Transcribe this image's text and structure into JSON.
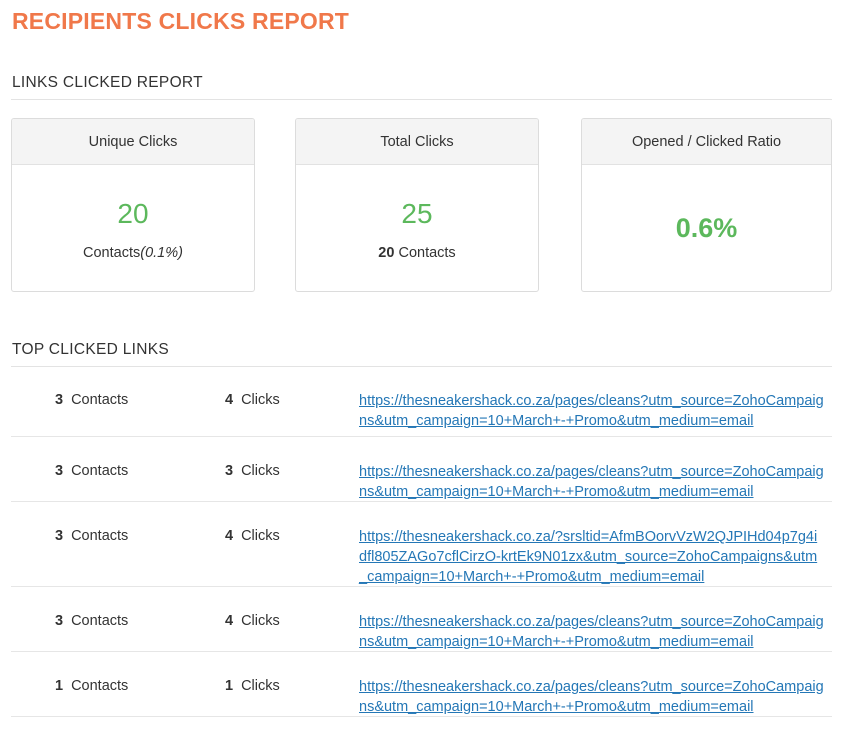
{
  "page": {
    "title": "RECIPIENTS CLICKS REPORT"
  },
  "links_report": {
    "heading": "LINKS CLICKED REPORT",
    "unique_clicks": {
      "label": "Unique Clicks",
      "value": "20",
      "sub_label": "Contacts",
      "sub_percent": "(0.1%)"
    },
    "total_clicks": {
      "label": "Total Clicks",
      "value": "25",
      "sub_count": "20",
      "sub_label": " Contacts"
    },
    "ratio": {
      "label": "Opened / Clicked Ratio",
      "value": "0.6%"
    }
  },
  "top_links": {
    "heading": "TOP CLICKED LINKS",
    "contacts_label": "Contacts",
    "clicks_label": "Clicks",
    "rows": [
      {
        "contacts": "3",
        "clicks": "4",
        "url": "https://thesneakershack.co.za/pages/cleans?utm_source=ZohoCampaigns&utm_campaign=10+March+-+Promo&utm_medium=email"
      },
      {
        "contacts": "3",
        "clicks": "3",
        "url": "https://thesneakershack.co.za/pages/cleans?utm_source=ZohoCampaigns&utm_campaign=10+March+-+Promo&utm_medium=email"
      },
      {
        "contacts": "3",
        "clicks": "4",
        "url": "https://thesneakershack.co.za/?srsltid=AfmBOorvVzW2QJPIHd04p7g4idfl805ZAGo7cflCirzO-krtEk9N01zx&utm_source=ZohoCampaigns&utm_campaign=10+March+-+Promo&utm_medium=email"
      },
      {
        "contacts": "3",
        "clicks": "4",
        "url": "https://thesneakershack.co.za/pages/cleans?utm_source=ZohoCampaigns&utm_campaign=10+March+-+Promo&utm_medium=email"
      },
      {
        "contacts": "1",
        "clicks": "1",
        "url": "https://thesneakershack.co.za/pages/cleans?utm_source=ZohoCampaigns&utm_campaign=10+March+-+Promo&utm_medium=email"
      }
    ]
  },
  "colors": {
    "title_orange": "#f0784a",
    "value_green": "#5cb85c",
    "link_blue": "#2477b6"
  }
}
